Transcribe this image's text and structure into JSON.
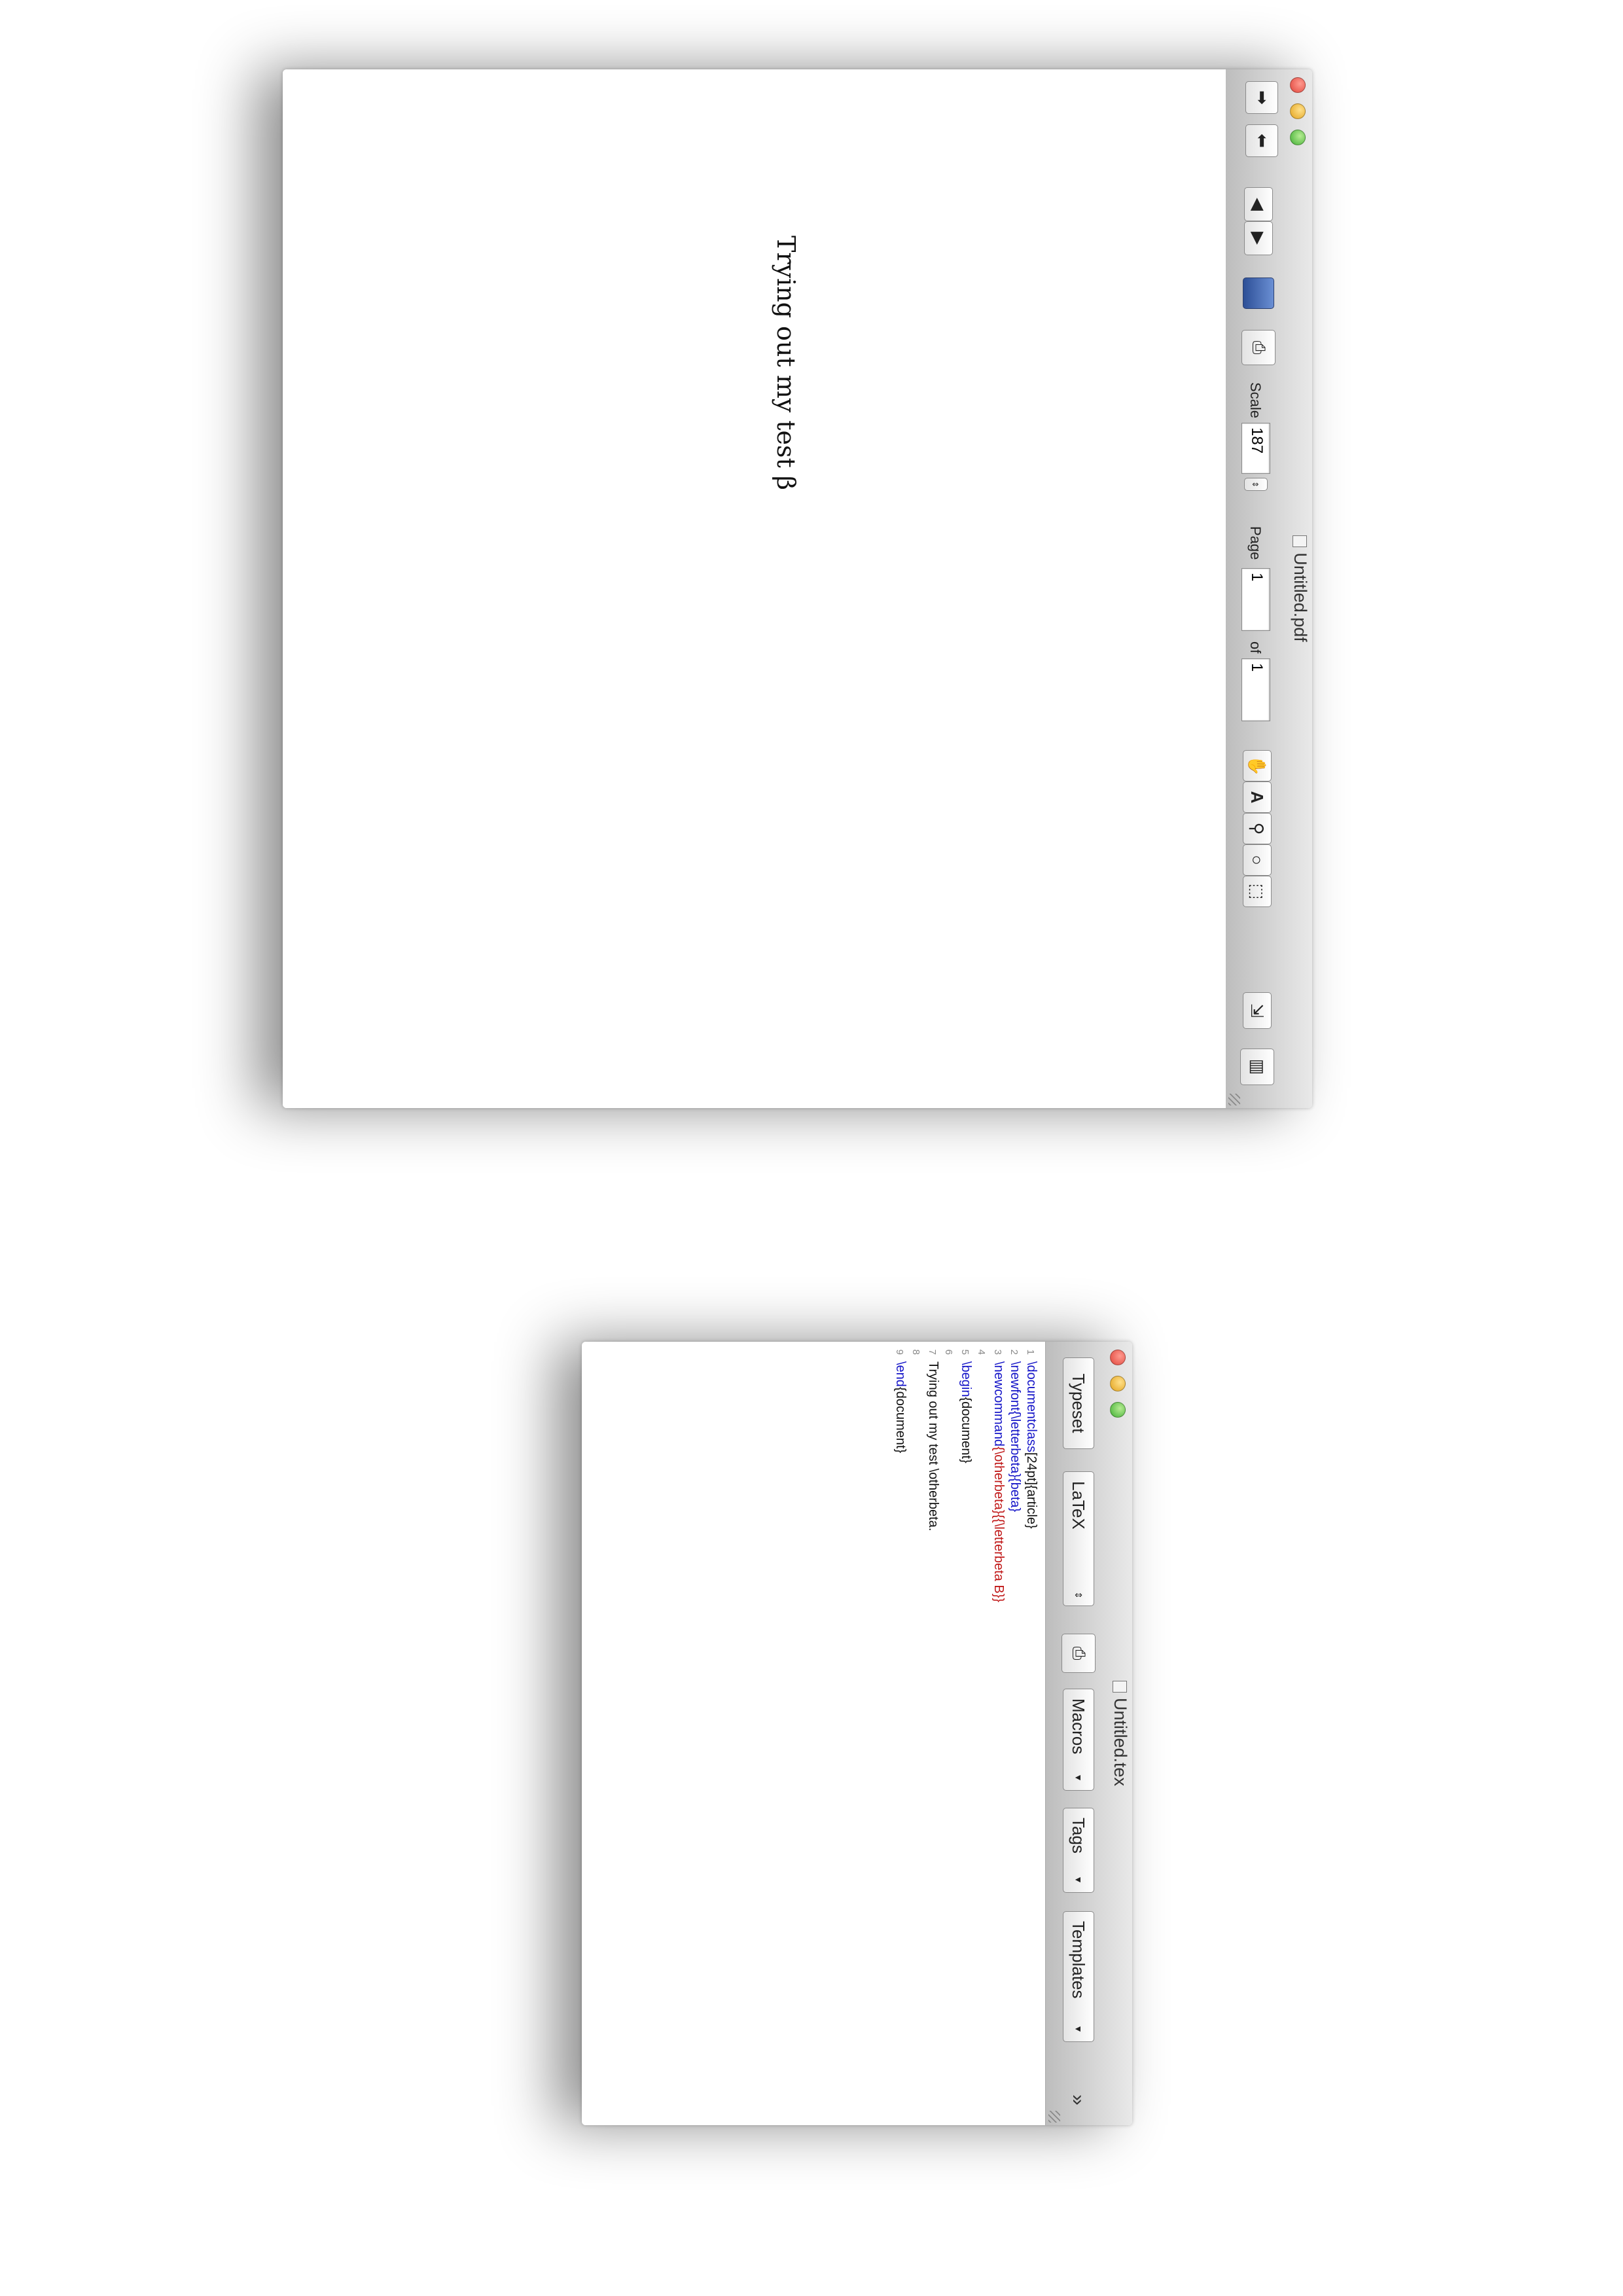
{
  "pdf_window": {
    "title": "Untitled.pdf",
    "scale_label": "Scale",
    "scale_value": "187",
    "page_label": "Page",
    "page_value": "1",
    "of_label": "of",
    "page_total": "1",
    "page_text": "Trying out my test β"
  },
  "tex_window": {
    "title": "Untitled.tex",
    "typeset_label": "Typeset",
    "engine_value": "LaTeX",
    "macros_label": "Macros",
    "tags_label": "Tags",
    "templates_label": "Templates",
    "lines": [
      {
        "num": "1",
        "cmd": "\\documentclass",
        "rest": "[24pt]{article}"
      },
      {
        "num": "2",
        "cmd": "\\newfont",
        "rest": "{\\letterbeta}{beta}"
      },
      {
        "num": "3",
        "cmd": "\\newcommand",
        "rest": "{\\otherbeta}{{\\letterbeta B}}"
      },
      {
        "num": "4",
        "cmd": "",
        "rest": ""
      },
      {
        "num": "5",
        "cmd": "\\begin",
        "rest": "{document}"
      },
      {
        "num": "6",
        "cmd": "",
        "rest": ""
      },
      {
        "num": "7",
        "cmd": "",
        "rest": "Trying out my test \\otherbeta."
      },
      {
        "num": "8",
        "cmd": "",
        "rest": ""
      },
      {
        "num": "9",
        "cmd": "\\end",
        "rest": "{document}"
      }
    ]
  }
}
